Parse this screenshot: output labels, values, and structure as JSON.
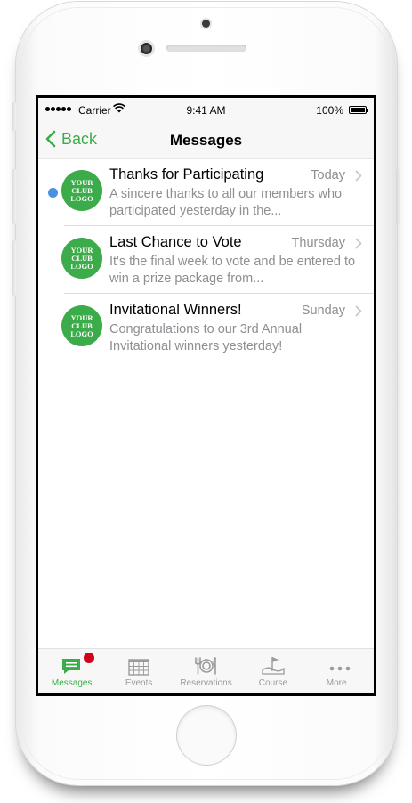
{
  "status_bar": {
    "carrier": "Carrier",
    "time": "9:41 AM",
    "battery": "100%"
  },
  "nav": {
    "back_label": "Back",
    "title": "Messages"
  },
  "colors": {
    "accent": "#3cab4a",
    "unread": "#4a90e2",
    "badge": "#d0021b"
  },
  "logo": {
    "line1": "YOUR",
    "line2": "CLUB",
    "line3": "LOGO"
  },
  "messages": [
    {
      "title": "Thanks for Participating",
      "date": "Today",
      "preview": "A sincere thanks to all our members who participated yesterday in the...",
      "unread": true
    },
    {
      "title": "Last Chance to Vote",
      "date": "Thursday",
      "preview": "It's the final week to vote and be entered to win a prize package from...",
      "unread": false
    },
    {
      "title": "Invitational Winners!",
      "date": "Sunday",
      "preview": "Congratulations to our 3rd Annual Invitational winners yesterday!",
      "unread": false
    }
  ],
  "tabs": [
    {
      "label": "Messages",
      "icon": "messages-icon",
      "active": true
    },
    {
      "label": "Events",
      "icon": "calendar-icon",
      "active": false
    },
    {
      "label": "Reservations",
      "icon": "dining-icon",
      "active": false
    },
    {
      "label": "Course",
      "icon": "golf-flag-icon",
      "active": false
    },
    {
      "label": "More...",
      "icon": "more-icon",
      "active": false
    }
  ]
}
